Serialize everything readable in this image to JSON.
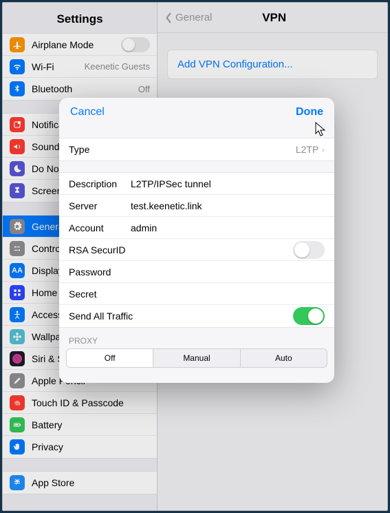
{
  "sidebar": {
    "title": "Settings",
    "groups": [
      [
        {
          "id": "airplane",
          "icon": "airplane",
          "bg": "#ff9500",
          "label": "Airplane Mode",
          "accessory": "toggle-off"
        },
        {
          "id": "wifi",
          "icon": "wifi",
          "bg": "#007aff",
          "label": "Wi-Fi",
          "value": "Keenetic Guests"
        },
        {
          "id": "bluetooth",
          "icon": "bluetooth",
          "bg": "#007aff",
          "label": "Bluetooth",
          "value": "Off"
        }
      ],
      [
        {
          "id": "notifications",
          "icon": "notifications",
          "bg": "#ff3b30",
          "label": "Notifications"
        },
        {
          "id": "sounds",
          "icon": "sounds",
          "bg": "#ff3b30",
          "label": "Sounds"
        },
        {
          "id": "dnd",
          "icon": "moon",
          "bg": "#5856d6",
          "label": "Do Not Disturb"
        },
        {
          "id": "screentime",
          "icon": "hourglass",
          "bg": "#5856d6",
          "label": "Screen Time"
        }
      ],
      [
        {
          "id": "general",
          "icon": "gear",
          "bg": "#8e8e93",
          "label": "General",
          "selected": true
        },
        {
          "id": "controlcenter",
          "icon": "switches",
          "bg": "#8e8e93",
          "label": "Control Center"
        },
        {
          "id": "display",
          "icon": "AA",
          "bg": "#007aff",
          "label": "Display & Brightness"
        },
        {
          "id": "home",
          "icon": "grid",
          "bg": "#2f45ff",
          "label": "Home Screen & Dock"
        },
        {
          "id": "accessibility",
          "icon": "figure",
          "bg": "#007aff",
          "label": "Accessibility"
        },
        {
          "id": "wallpaper",
          "icon": "flower",
          "bg": "#56c1d6",
          "label": "Wallpaper"
        },
        {
          "id": "siri",
          "icon": "siri",
          "bg": "#1c1c2e",
          "label": "Siri & Search"
        },
        {
          "id": "pencil",
          "icon": "pencil",
          "bg": "#8e8e93",
          "label": "Apple Pencil"
        },
        {
          "id": "touchid",
          "icon": "fingerprint",
          "bg": "#ff3b30",
          "label": "Touch ID & Passcode"
        },
        {
          "id": "battery",
          "icon": "battery",
          "bg": "#34c759",
          "label": "Battery"
        },
        {
          "id": "privacy",
          "icon": "hand",
          "bg": "#007aff",
          "label": "Privacy"
        }
      ],
      [
        {
          "id": "appstore",
          "icon": "appstore",
          "bg": "#1e90ff",
          "label": "App Store"
        }
      ]
    ]
  },
  "detail": {
    "back": "General",
    "title": "VPN",
    "addLabel": "Add VPN Configuration..."
  },
  "modal": {
    "cancel": "Cancel",
    "done": "Done",
    "type_label": "Type",
    "type_value": "L2TP",
    "description_label": "Description",
    "description_value": "L2TP/IPSec tunnel",
    "server_label": "Server",
    "server_value": "test.keenetic.link",
    "account_label": "Account",
    "account_value": "admin",
    "rsa_label": "RSA SecurID",
    "rsa_on": false,
    "password_label": "Password",
    "secret_label": "Secret",
    "sendall_label": "Send All Traffic",
    "sendall_on": true,
    "proxy_label": "Proxy",
    "seg_off": "Off",
    "seg_manual": "Manual",
    "seg_auto": "Auto",
    "seg_selected": 0
  }
}
